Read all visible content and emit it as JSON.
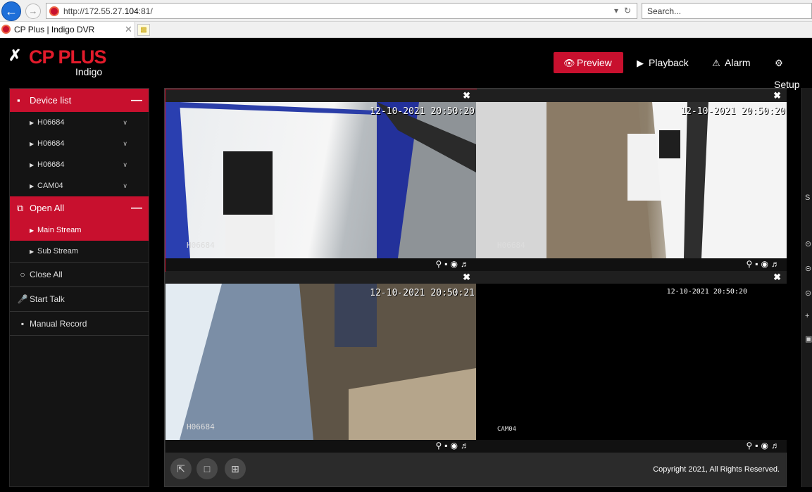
{
  "browser": {
    "url_prefix": "http://172.55.27.",
    "url_host": "104",
    "url_suffix": ":81/",
    "search_placeholder": "Search...",
    "tab_title": "CP Plus | Indigo DVR"
  },
  "header": {
    "brand": "CP PLUS",
    "product": "Indigo",
    "nav": {
      "preview": "Preview",
      "playback": "Playback",
      "alarm": "Alarm",
      "setup": "Setup"
    }
  },
  "sidebar": {
    "device_list": "Device list",
    "devices": [
      "H06684",
      "H06684",
      "H06684",
      "CAM04"
    ],
    "open_all": "Open All",
    "main_stream": "Main Stream",
    "sub_stream": "Sub Stream",
    "close_all": "Close All",
    "start_talk": "Start Talk",
    "manual_record": "Manual Record"
  },
  "cells": [
    {
      "timestamp": "12-10-2021 20:50:20",
      "camera": "H06684"
    },
    {
      "timestamp": "12-10-2021 20:50:20",
      "camera": "H06684"
    },
    {
      "timestamp": "12-10-2021 20:50:21",
      "camera": "H06684"
    },
    {
      "timestamp": "12-10-2021 20:50:20",
      "camera": "CAM04"
    }
  ],
  "footer": {
    "copyright": "Copyright 2021, All Rights Reserved."
  },
  "colors": {
    "accent": "#c8102e",
    "background": "#000000",
    "panel": "#141414"
  }
}
